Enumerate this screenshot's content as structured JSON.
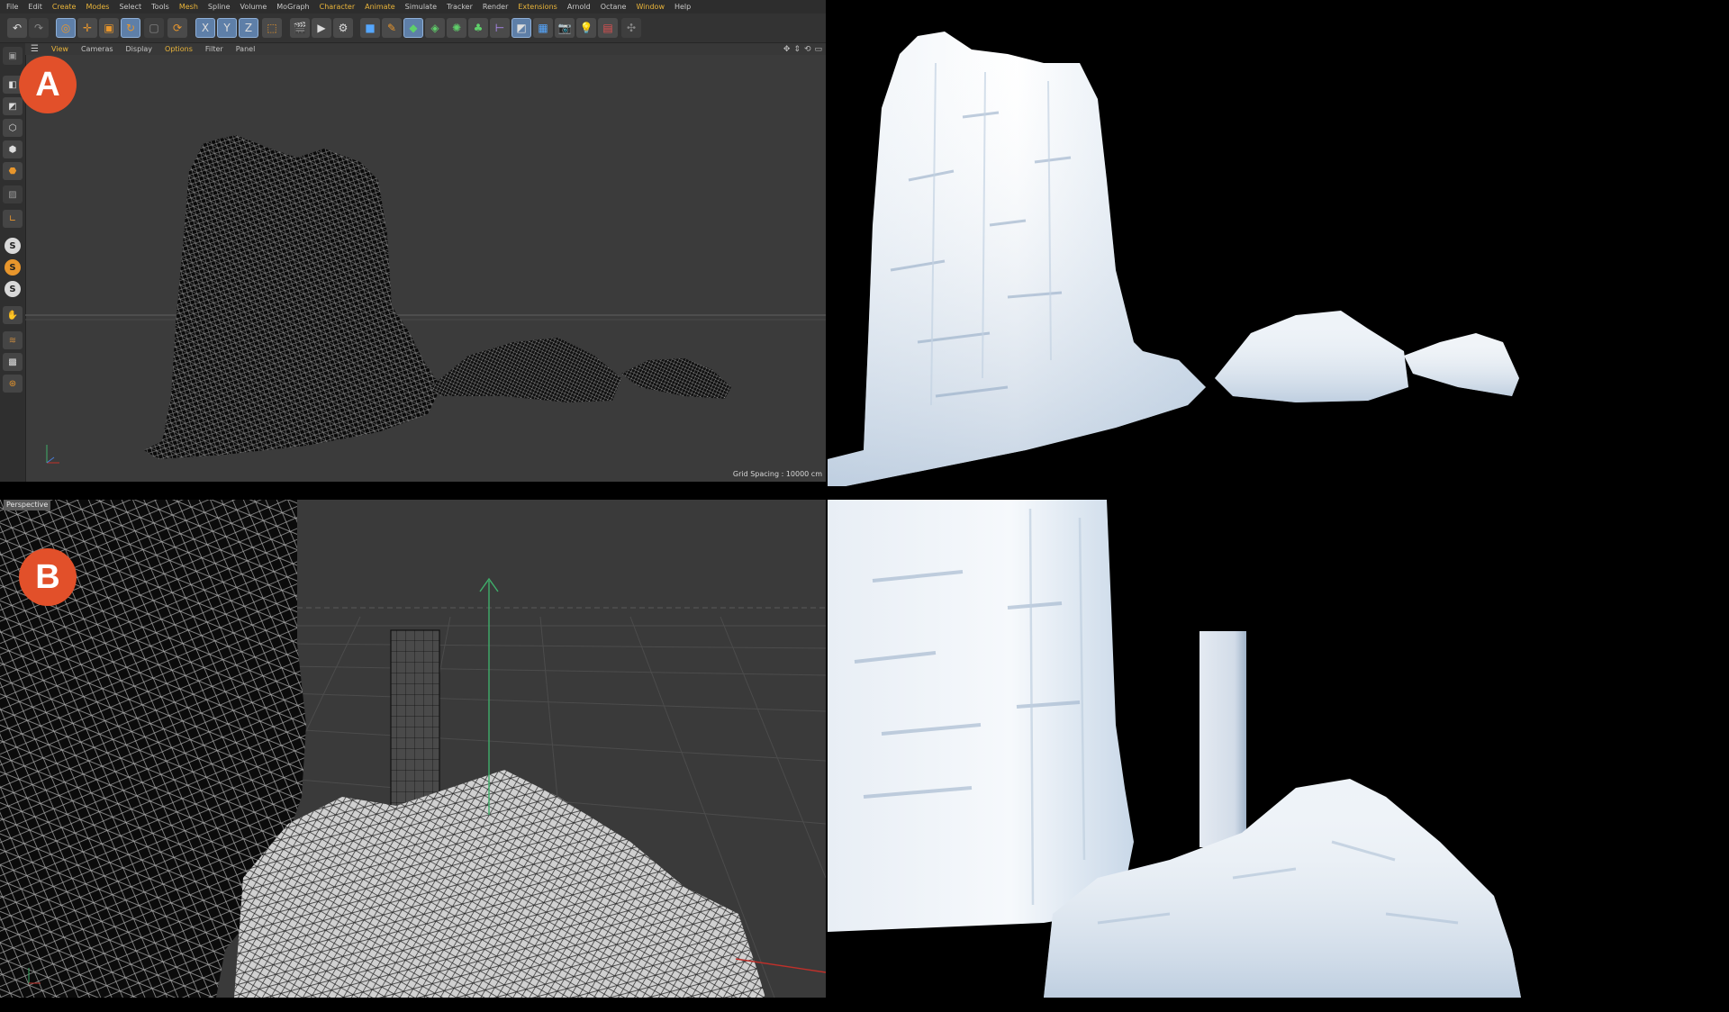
{
  "menubar": {
    "items": [
      {
        "label": "File",
        "hl": false
      },
      {
        "label": "Edit",
        "hl": false
      },
      {
        "label": "Create",
        "hl": true
      },
      {
        "label": "Modes",
        "hl": true
      },
      {
        "label": "Select",
        "hl": false
      },
      {
        "label": "Tools",
        "hl": false
      },
      {
        "label": "Mesh",
        "hl": true
      },
      {
        "label": "Spline",
        "hl": false
      },
      {
        "label": "Volume",
        "hl": false
      },
      {
        "label": "MoGraph",
        "hl": false
      },
      {
        "label": "Character",
        "hl": true
      },
      {
        "label": "Animate",
        "hl": true
      },
      {
        "label": "Simulate",
        "hl": false
      },
      {
        "label": "Tracker",
        "hl": false
      },
      {
        "label": "Render",
        "hl": false
      },
      {
        "label": "Extensions",
        "hl": true
      },
      {
        "label": "Arnold",
        "hl": false
      },
      {
        "label": "Octane",
        "hl": false
      },
      {
        "label": "Window",
        "hl": true
      },
      {
        "label": "Help",
        "hl": false
      }
    ]
  },
  "toolbar": {
    "axis_x": "X",
    "axis_y": "Y",
    "axis_z": "Z"
  },
  "viewmenu": {
    "items": [
      {
        "label": "View",
        "hl": true
      },
      {
        "label": "Cameras",
        "hl": false
      },
      {
        "label": "Display",
        "hl": false
      },
      {
        "label": "Options",
        "hl": true
      },
      {
        "label": "Filter",
        "hl": false
      },
      {
        "label": "Panel",
        "hl": false
      }
    ]
  },
  "left_toolbar": {
    "s1": "S",
    "s2": "S",
    "s3": "S"
  },
  "viewport_a": {
    "grid_spacing": "Grid Spacing : 10000 cm"
  },
  "viewport_b": {
    "camera": "Perspective"
  },
  "labels": {
    "a": "A",
    "b": "B"
  },
  "colors": {
    "accent": "#e9b43a",
    "label_red": "#e2502a",
    "selected_blue": "#5e7fa8",
    "axis_green": "#3fae6a",
    "axis_red": "#c0302a"
  }
}
